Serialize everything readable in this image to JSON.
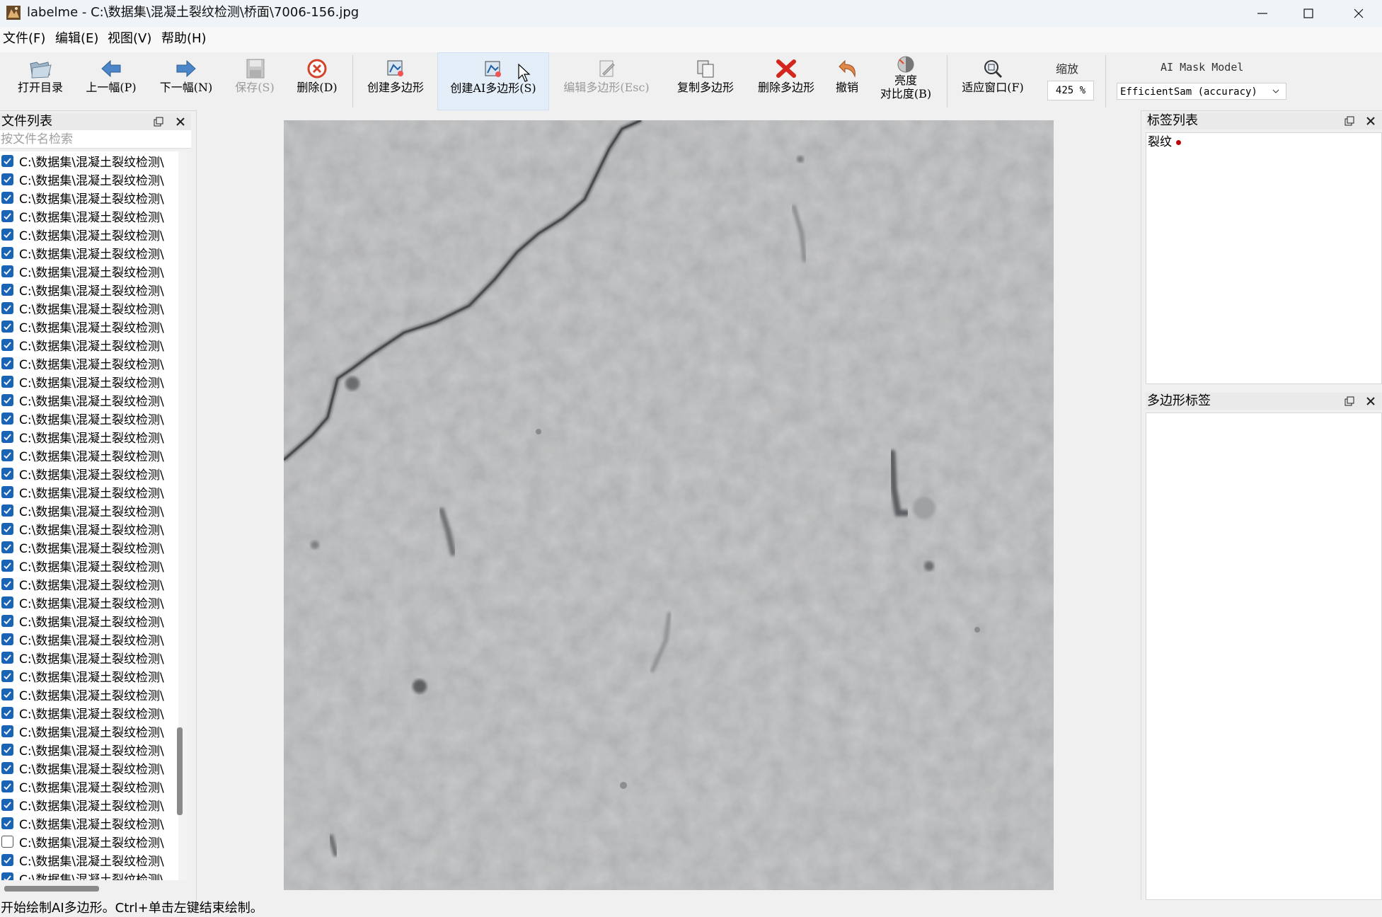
{
  "window": {
    "title": "labelme - C:\\数据集\\混凝土裂纹检测\\桥面\\7006-156.jpg"
  },
  "menu": [
    "文件(F)",
    "编辑(E)",
    "视图(V)",
    "帮助(H)"
  ],
  "toolbar": {
    "open_dir": "打开目录",
    "prev": "上一幅(P)",
    "next": "下一幅(N)",
    "save": "保存(S)",
    "delete": "删除(D)",
    "create_polygon": "创建多边形",
    "create_ai_polygon": "创建AI多边形(S)",
    "edit_polygon": "编辑多边形(Esc)",
    "copy_polygon": "复制多边形",
    "delete_polygon": "删除多边形",
    "undo": "撤销",
    "brightness_line1": "亮度",
    "brightness_line2": "对比度(B)",
    "fit_window": "适应窗口(F)",
    "zoom_label": "缩放",
    "zoom_value": "425 %",
    "ai_model_title": "AI Mask Model",
    "ai_model_value": "EfficientSam (accuracy)"
  },
  "file_panel": {
    "title": "文件列表",
    "search_placeholder": "按文件名检索",
    "item_text": "C:\\数据集\\混凝土裂纹检测\\",
    "items_checked": [
      true,
      true,
      true,
      true,
      true,
      true,
      true,
      true,
      true,
      true,
      true,
      true,
      true,
      true,
      true,
      true,
      true,
      true,
      true,
      true,
      true,
      true,
      true,
      true,
      true,
      true,
      true,
      true,
      true,
      true,
      true,
      true,
      true,
      true,
      true,
      true,
      true,
      false,
      true,
      true,
      true
    ]
  },
  "label_panel": {
    "title": "标签列表",
    "labels": [
      {
        "name": "裂纹",
        "color": "#c00000"
      }
    ]
  },
  "polygon_panel": {
    "title": "多边形标签"
  },
  "status": "开始绘制AI多边形。Ctrl+单击左键结束绘制。",
  "colors": {
    "checkbox": "#1a64b6",
    "label_dot": "#c00000",
    "concrete": "#c4c5c6"
  },
  "icons": {
    "open_dir": "folder-open-icon",
    "prev": "arrow-left-icon",
    "next": "arrow-right-icon",
    "save": "floppy-icon",
    "delete": "delete-circle-icon",
    "create_polygon": "create-polygon-icon",
    "create_ai_polygon": "create-ai-polygon-icon",
    "edit_polygon": "edit-icon",
    "copy_polygon": "copy-icon",
    "delete_polygon": "red-x-icon",
    "undo": "undo-icon",
    "brightness": "brightness-icon",
    "fit_window": "zoom-fit-icon"
  }
}
